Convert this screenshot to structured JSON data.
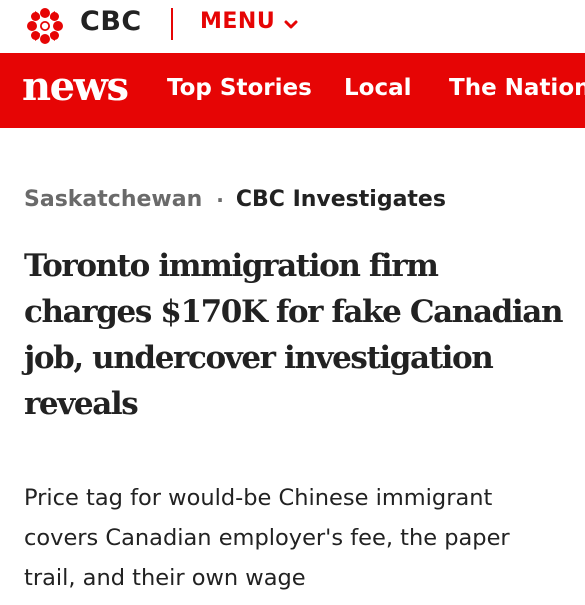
{
  "brand": {
    "name": "CBC",
    "accent_color": "#e60505"
  },
  "menu": {
    "label": "MENU",
    "icon": "chevron-down-icon"
  },
  "nav": {
    "section_logo": "news",
    "items": [
      {
        "label": "Top Stories"
      },
      {
        "label": "Local"
      },
      {
        "label": "The National"
      }
    ]
  },
  "article": {
    "region": "Saskatchewan",
    "separator": "·",
    "series": "CBC Investigates",
    "headline": "Toronto immigration firm charges $170K for fake Canadian job, undercover investigation reveals",
    "deck": "Price tag for would-be Chinese immigrant covers Canadian employer's fee, the paper trail, and their own wage"
  }
}
